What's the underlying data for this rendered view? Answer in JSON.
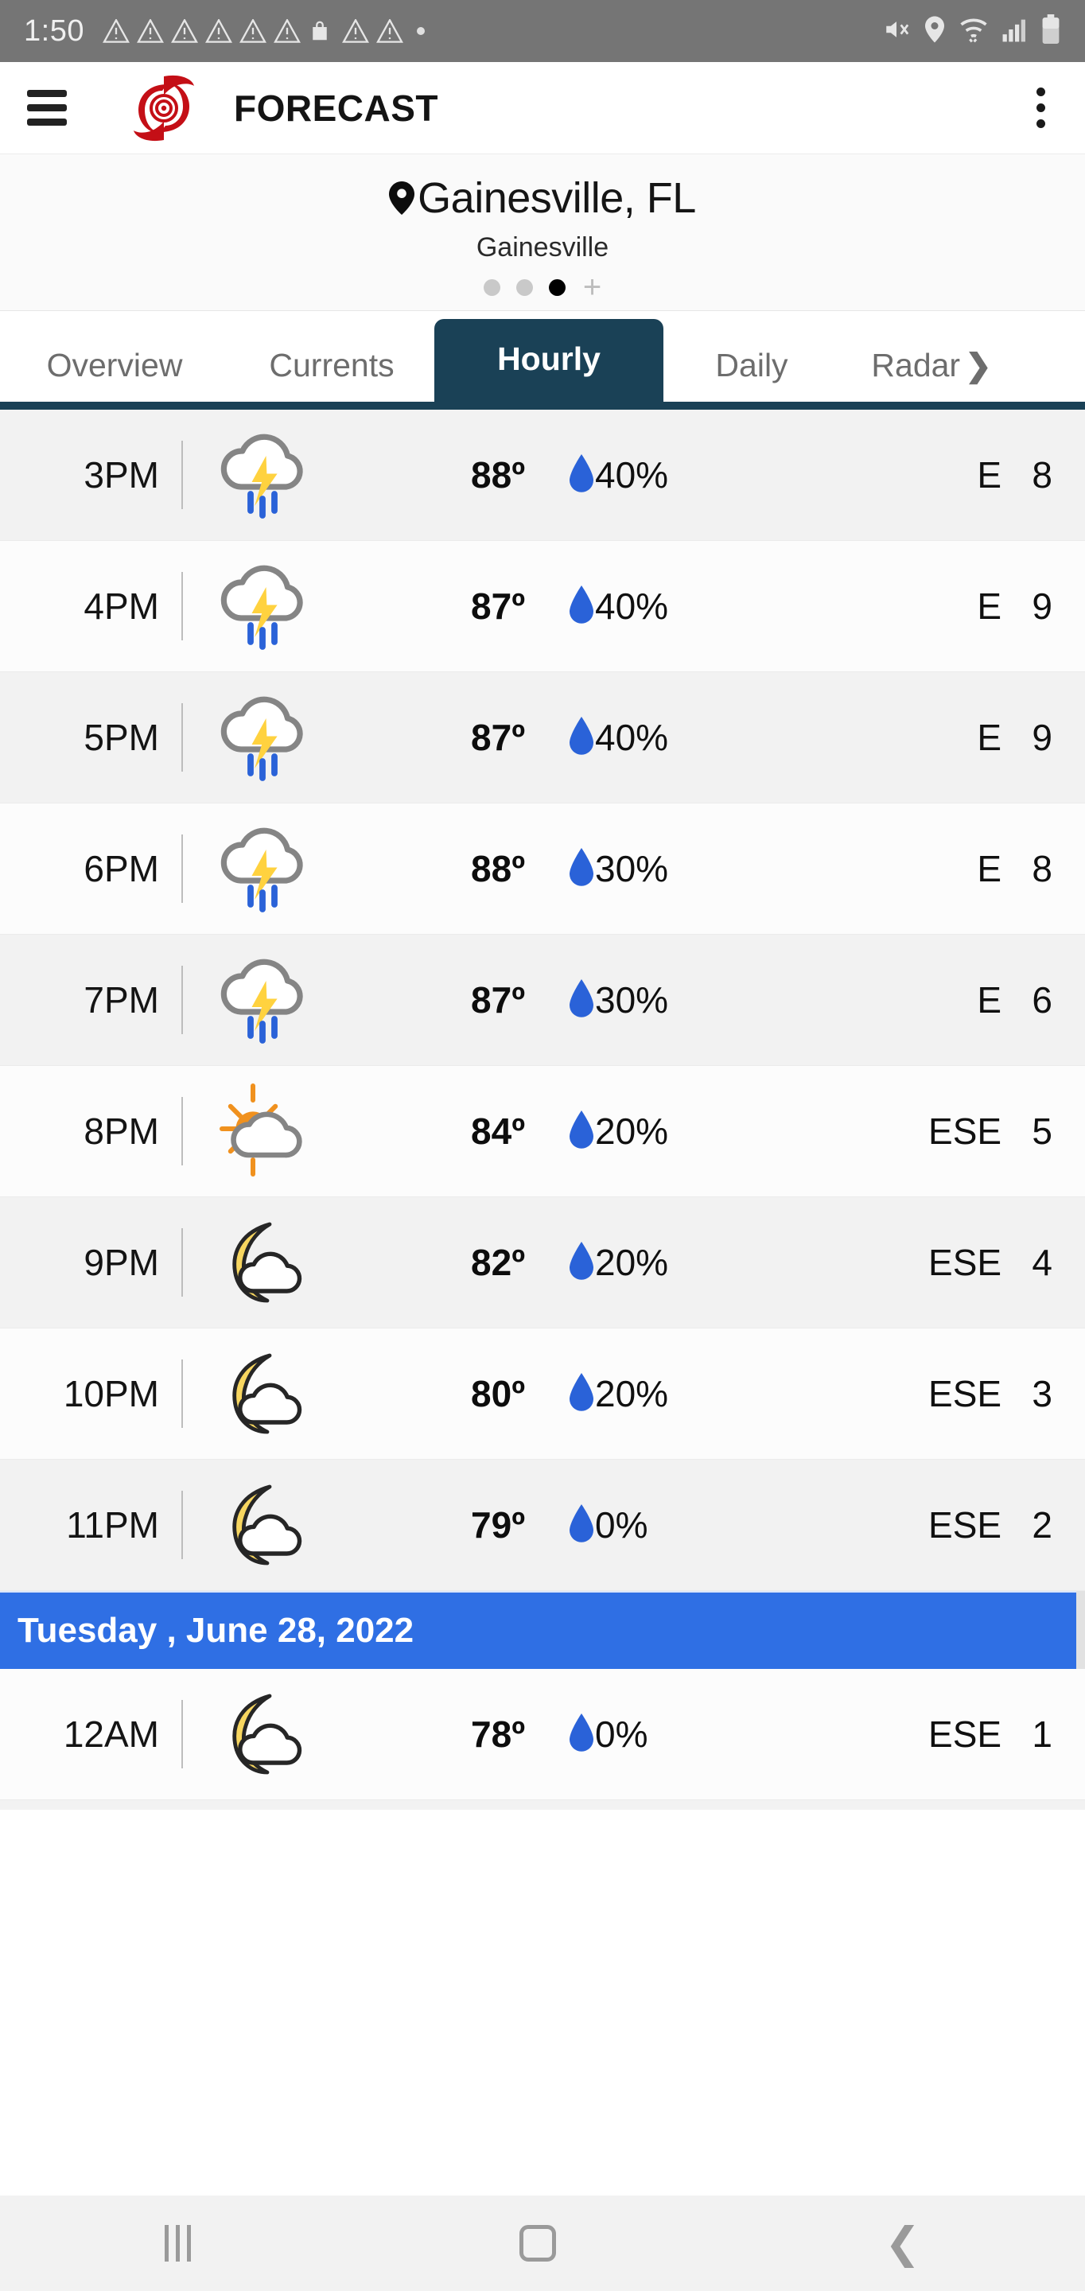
{
  "status_bar": {
    "time": "1:50",
    "left_icons": [
      "warning-icon",
      "warning-icon",
      "warning-icon",
      "warning-icon",
      "warning-icon",
      "warning-icon",
      "shopping-bag-icon",
      "warning-icon",
      "warning-icon",
      "dot-icon"
    ],
    "right_icons": [
      "mute-icon",
      "location-icon",
      "wifi-icon",
      "signal-icon",
      "battery-icon"
    ]
  },
  "app_bar": {
    "menu_icon": "hamburger-icon",
    "logo": "hurricane-logo",
    "title": "FORECAST",
    "overflow_icon": "kebab-menu-icon"
  },
  "location": {
    "pin_icon": "map-pin-icon",
    "title": "Gainesville, FL",
    "subtitle": "Gainesville",
    "pager": {
      "count": 3,
      "active_index": 2,
      "add_label": "+"
    }
  },
  "tabs": {
    "items": [
      {
        "label": "Overview",
        "active": false
      },
      {
        "label": "Currents",
        "active": false
      },
      {
        "label": "Hourly",
        "active": true
      },
      {
        "label": "Daily",
        "active": false
      },
      {
        "label": "Radar",
        "active": false
      }
    ],
    "more_icon": "chevron-right-icon",
    "active_bg": "#1a4156"
  },
  "hourly": {
    "columns": [
      "time",
      "condition",
      "temperature",
      "precip_chance",
      "wind"
    ],
    "rows": [
      {
        "time": "3PM",
        "icon": "thunderstorm-icon",
        "temp": "88º",
        "pop": "40%",
        "wind": "E   8"
      },
      {
        "time": "4PM",
        "icon": "thunderstorm-icon",
        "temp": "87º",
        "pop": "40%",
        "wind": "E   9"
      },
      {
        "time": "5PM",
        "icon": "thunderstorm-icon",
        "temp": "87º",
        "pop": "40%",
        "wind": "E   9"
      },
      {
        "time": "6PM",
        "icon": "thunderstorm-icon",
        "temp": "88º",
        "pop": "30%",
        "wind": "E   8"
      },
      {
        "time": "7PM",
        "icon": "thunderstorm-icon",
        "temp": "87º",
        "pop": "30%",
        "wind": "E   6"
      },
      {
        "time": "8PM",
        "icon": "sun-behind-cloud-icon",
        "temp": "84º",
        "pop": "20%",
        "wind": "ESE   5"
      },
      {
        "time": "9PM",
        "icon": "moon-behind-cloud-icon",
        "temp": "82º",
        "pop": "20%",
        "wind": "ESE   4"
      },
      {
        "time": "10PM",
        "icon": "moon-behind-cloud-icon",
        "temp": "80º",
        "pop": "20%",
        "wind": "ESE   3"
      },
      {
        "time": "11PM",
        "icon": "moon-behind-cloud-icon",
        "temp": "79º",
        "pop": "0%",
        "wind": "ESE   2"
      }
    ],
    "date_separator": "Tuesday , June 28, 2022",
    "date_separator_color": "#2f6fe4",
    "rows_after_separator": [
      {
        "time": "12AM",
        "icon": "moon-behind-cloud-icon",
        "temp": "78º",
        "pop": "0%",
        "wind": "ESE   1"
      }
    ],
    "droplet_color": "#2a62d8",
    "scrollbar": "vertical-scrollbar"
  },
  "nav_bar": {
    "recents": "recents-icon",
    "home": "home-icon",
    "back": "back-icon"
  }
}
